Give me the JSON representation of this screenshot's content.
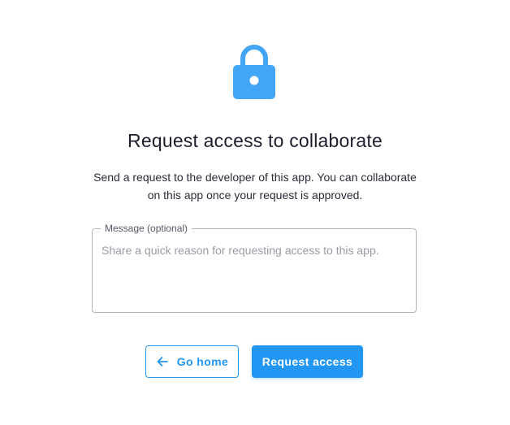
{
  "lock": {
    "icon": "lock-icon",
    "color": "#42a5f5"
  },
  "title": "Request access to collaborate",
  "description": "Send a request to the developer of this app. You can collaborate on this app once your request is approved.",
  "message": {
    "label": "Message (optional)",
    "value": "",
    "placeholder": "Share a quick reason for requesting access to this app."
  },
  "buttons": {
    "go_home": {
      "label": "Go home",
      "icon": "arrow-left-icon"
    },
    "request_access": {
      "label": "Request access"
    }
  },
  "colors": {
    "accent": "#2196f3",
    "title": "#1c1d2e",
    "border": "#b4b4b4"
  }
}
